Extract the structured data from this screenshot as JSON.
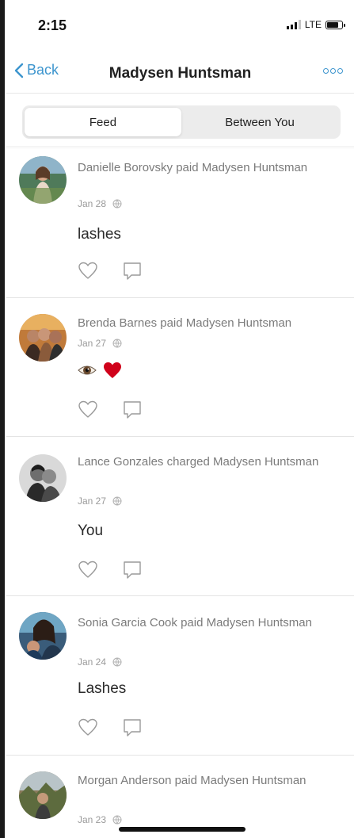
{
  "status_bar": {
    "time": "2:15",
    "network": "LTE"
  },
  "nav": {
    "back_label": "Back",
    "title": "Madysen Huntsman"
  },
  "tabs": [
    {
      "label": "Feed",
      "active": true
    },
    {
      "label": "Between You",
      "active": false
    }
  ],
  "colors": {
    "accent": "#3d95ce",
    "heart": "#d0021b"
  },
  "feed": [
    {
      "title": "Danielle Borovsky paid Madysen Huntsman",
      "date": "Jan 28",
      "note": "lashes"
    },
    {
      "title": "Brenda Barnes paid Madysen Huntsman",
      "date": "Jan 27",
      "note_icons": [
        "eye-emoji",
        "red-heart-emoji"
      ]
    },
    {
      "title": "Lance Gonzales charged Madysen Huntsman",
      "date": "Jan 27",
      "note": "You"
    },
    {
      "title": "Sonia Garcia Cook paid Madysen Huntsman",
      "date": "Jan 24",
      "note": "Lashes"
    },
    {
      "title": "Morgan Anderson paid Madysen Huntsman",
      "date": "Jan 23"
    }
  ]
}
